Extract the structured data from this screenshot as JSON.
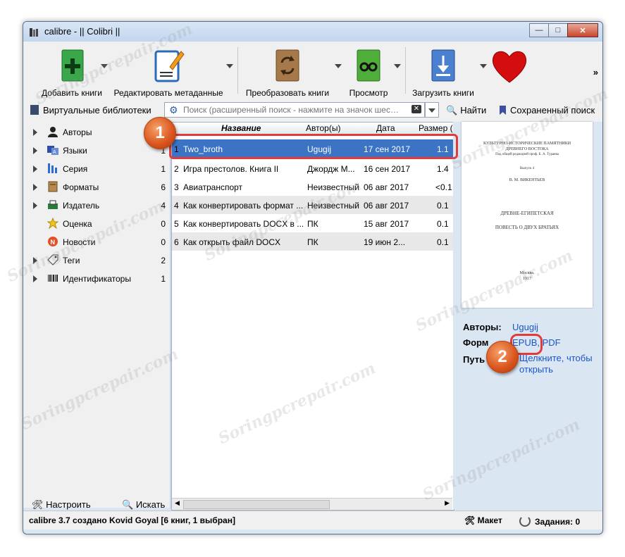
{
  "window": {
    "title": "calibre - || Colibri ||"
  },
  "toolbar": {
    "buttons": [
      {
        "label": "Добавить книги",
        "icon": "add-book-icon"
      },
      {
        "label": "Редактировать метаданные",
        "icon": "edit-metadata-icon"
      },
      {
        "label": "Преобразовать книги",
        "icon": "convert-books-icon"
      },
      {
        "label": "Просмотр",
        "icon": "view-book-icon"
      },
      {
        "label": "Загрузить книги",
        "icon": "download-books-icon"
      },
      {
        "label": "",
        "icon": "heart-icon"
      }
    ],
    "more": "»"
  },
  "search": {
    "virtual_libraries": "Виртуальные библиотеки",
    "placeholder": "Поиск (расширенный поиск - нажмите на значок шес…",
    "find_label": "Найти",
    "saved_label": "Сохраненный поиск"
  },
  "tag_browser": {
    "items": [
      {
        "label": "Авторы",
        "count": "",
        "icon": "person-icon"
      },
      {
        "label": "Языки",
        "count": "1",
        "icon": "languages-icon"
      },
      {
        "label": "Серия",
        "count": "1",
        "icon": "series-icon"
      },
      {
        "label": "Форматы",
        "count": "6",
        "icon": "formats-icon"
      },
      {
        "label": "Издатель",
        "count": "4",
        "icon": "publisher-icon"
      },
      {
        "label": "Оценка",
        "count": "0",
        "icon": "star-icon"
      },
      {
        "label": "Новости",
        "count": "0",
        "icon": "news-icon"
      },
      {
        "label": "Теги",
        "count": "2",
        "icon": "tag-icon"
      },
      {
        "label": "Идентификаторы",
        "count": "1",
        "icon": "barcode-icon"
      }
    ],
    "configure_label": "Настроить",
    "find_label": "Искать"
  },
  "book_list": {
    "columns": [
      "Название",
      "Автор(ы)",
      "Дата",
      "Размер ("
    ],
    "rows": [
      {
        "num": "1",
        "title": "Two_broth",
        "author": "Ugugij",
        "date": "17 сен 2017",
        "size": "1.1"
      },
      {
        "num": "2",
        "title": "Игра престолов. Книга II",
        "author": "Джордж М...",
        "date": "16 сен 2017",
        "size": "1.4"
      },
      {
        "num": "3",
        "title": "Авиатранспорт",
        "author": "Неизвестный",
        "date": "06 авг 2017",
        "size": "<0.1"
      },
      {
        "num": "4",
        "title": "Как конвертировать формат ...",
        "author": "Неизвестный",
        "date": "06 авг 2017",
        "size": "0.1"
      },
      {
        "num": "5",
        "title": "Как конвертировать DOCX в ...",
        "author": "ПК",
        "date": "15 авг 2017",
        "size": "0.1"
      },
      {
        "num": "6",
        "title": "Как открыть файл DOCX",
        "author": "ПК",
        "date": "19 июн 2...",
        "size": "0.1"
      }
    ]
  },
  "cover": {
    "lines": [
      "КУЛЬТУРНО-ИСТОРИЧЕСКИЕ ПАМЯТНИКИ",
      "ДРЕВНЕГО ВОСТОКА",
      "Под общей редакцией проф. Б. А. Тураева",
      "Выпуск 4",
      "В. М. ВИКЕНТЬЕВ",
      "ДРЕВНЕ-ЕГИПЕТСКАЯ",
      "ПОВЕСТЬ О ДВУХ БРАТЬЯХ",
      "Москва.",
      "1917"
    ]
  },
  "details": {
    "authors_label": "Авторы:",
    "authors_value": "Ugugij",
    "formats_label": "Форм",
    "formats_value": "EPUB, PDF",
    "path_label": "Путь",
    "path_value_1": "Щелкните, чтобы",
    "path_value_2": "открыть"
  },
  "status": {
    "left": "calibre 3.7 создано Kovid Goyal   [6 книг, 1 выбран]",
    "layout": "Макет",
    "jobs": "Задания: 0"
  },
  "annotations": {
    "badge1": "1",
    "badge2": "2",
    "highlight_color": "#e23b3b",
    "badge_color": "#d9531c"
  },
  "watermark": "Soringpcrepair.com"
}
